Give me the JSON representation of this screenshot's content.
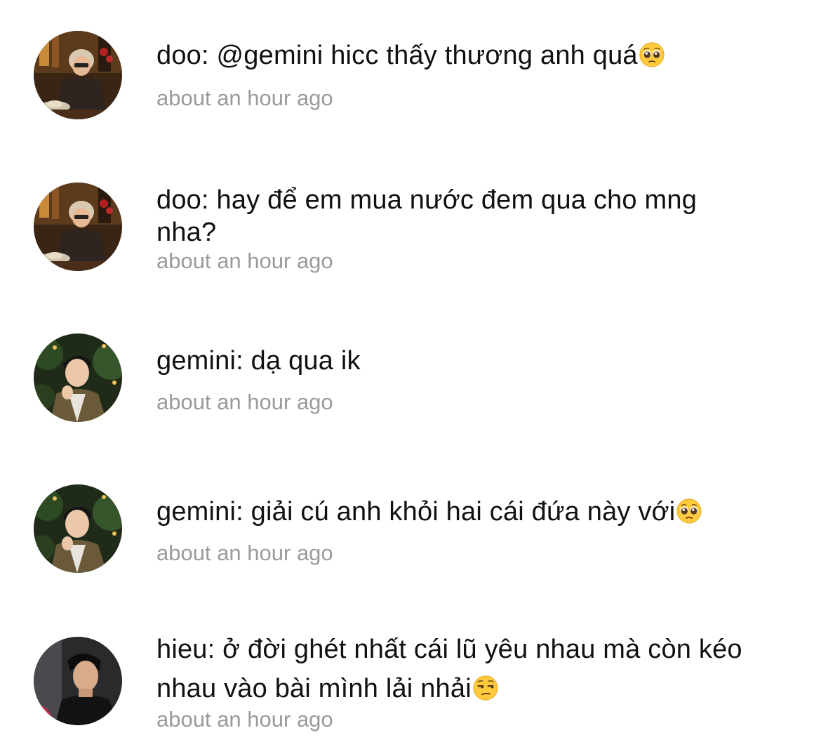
{
  "comments": [
    {
      "text": "doo: @gemini hicc thấy thương anh quá",
      "emoji": "pleading-face-emoji",
      "time": "about an hour ago",
      "avatar": "avatar-doo"
    },
    {
      "text": "doo: hay để em mua nước đem qua cho mng nha?",
      "emoji": "",
      "time": "about an hour ago",
      "avatar": "avatar-doo"
    },
    {
      "text": "gemini: dạ qua ik",
      "emoji": "",
      "time": "about an hour ago",
      "avatar": "avatar-gemini"
    },
    {
      "text": "gemini: giải cú anh khỏi hai cái đứa này với",
      "emoji": "pleading-face-emoji",
      "time": "about an hour ago",
      "avatar": "avatar-gemini"
    },
    {
      "text": "hieu: ở đời ghét nhất cái lũ yêu nhau mà còn kéo nhau vào bài mình lải nhải",
      "emoji": "unamused-face-emoji",
      "time": "about an hour ago",
      "avatar": "avatar-hieu"
    }
  ],
  "colors": {
    "text": "#111111",
    "timestamp": "#9a9a9a",
    "background": "#ffffff"
  }
}
